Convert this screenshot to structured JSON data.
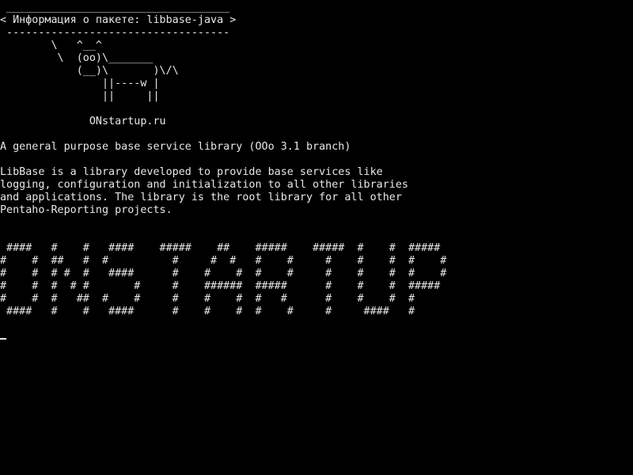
{
  "cowsay": {
    "lines": [
      " ___________________________________",
      "< Информация о пакете: libbase-java >",
      " -----------------------------------",
      "        \\   ^__^",
      "         \\  (oo)\\_______",
      "            (__)\\       )\\/\\",
      "                ||----w |",
      "                ||     ||",
      "",
      "              ONstartup.ru"
    ]
  },
  "description": {
    "lines": [
      "A general purpose base service library (OOo 3.1 branch)",
      "",
      "LibBase is a library developed to provide base services like",
      "logging, configuration and initialization to all other libraries",
      "and applications. The library is the root library for all other",
      "Pentaho-Reporting projects."
    ]
  },
  "banner": {
    "lines": [
      " ####   #    #   ####    #####    ##    #####    #####  #    #  #####",
      "#    #  ##   #  #          #     #  #   #    #     #    #    #  #    #",
      "#    #  # #  #   ####      #    #    #  #    #     #    #    #  #    #",
      "#    #  #  # #       #     #    ######  #####      #    #    #  #####",
      "#    #  #   ##  #    #     #    #    #  #   #      #    #    #  #",
      " ####   #    #   ####      #    #    #  #    #     #     ####   #"
    ]
  }
}
